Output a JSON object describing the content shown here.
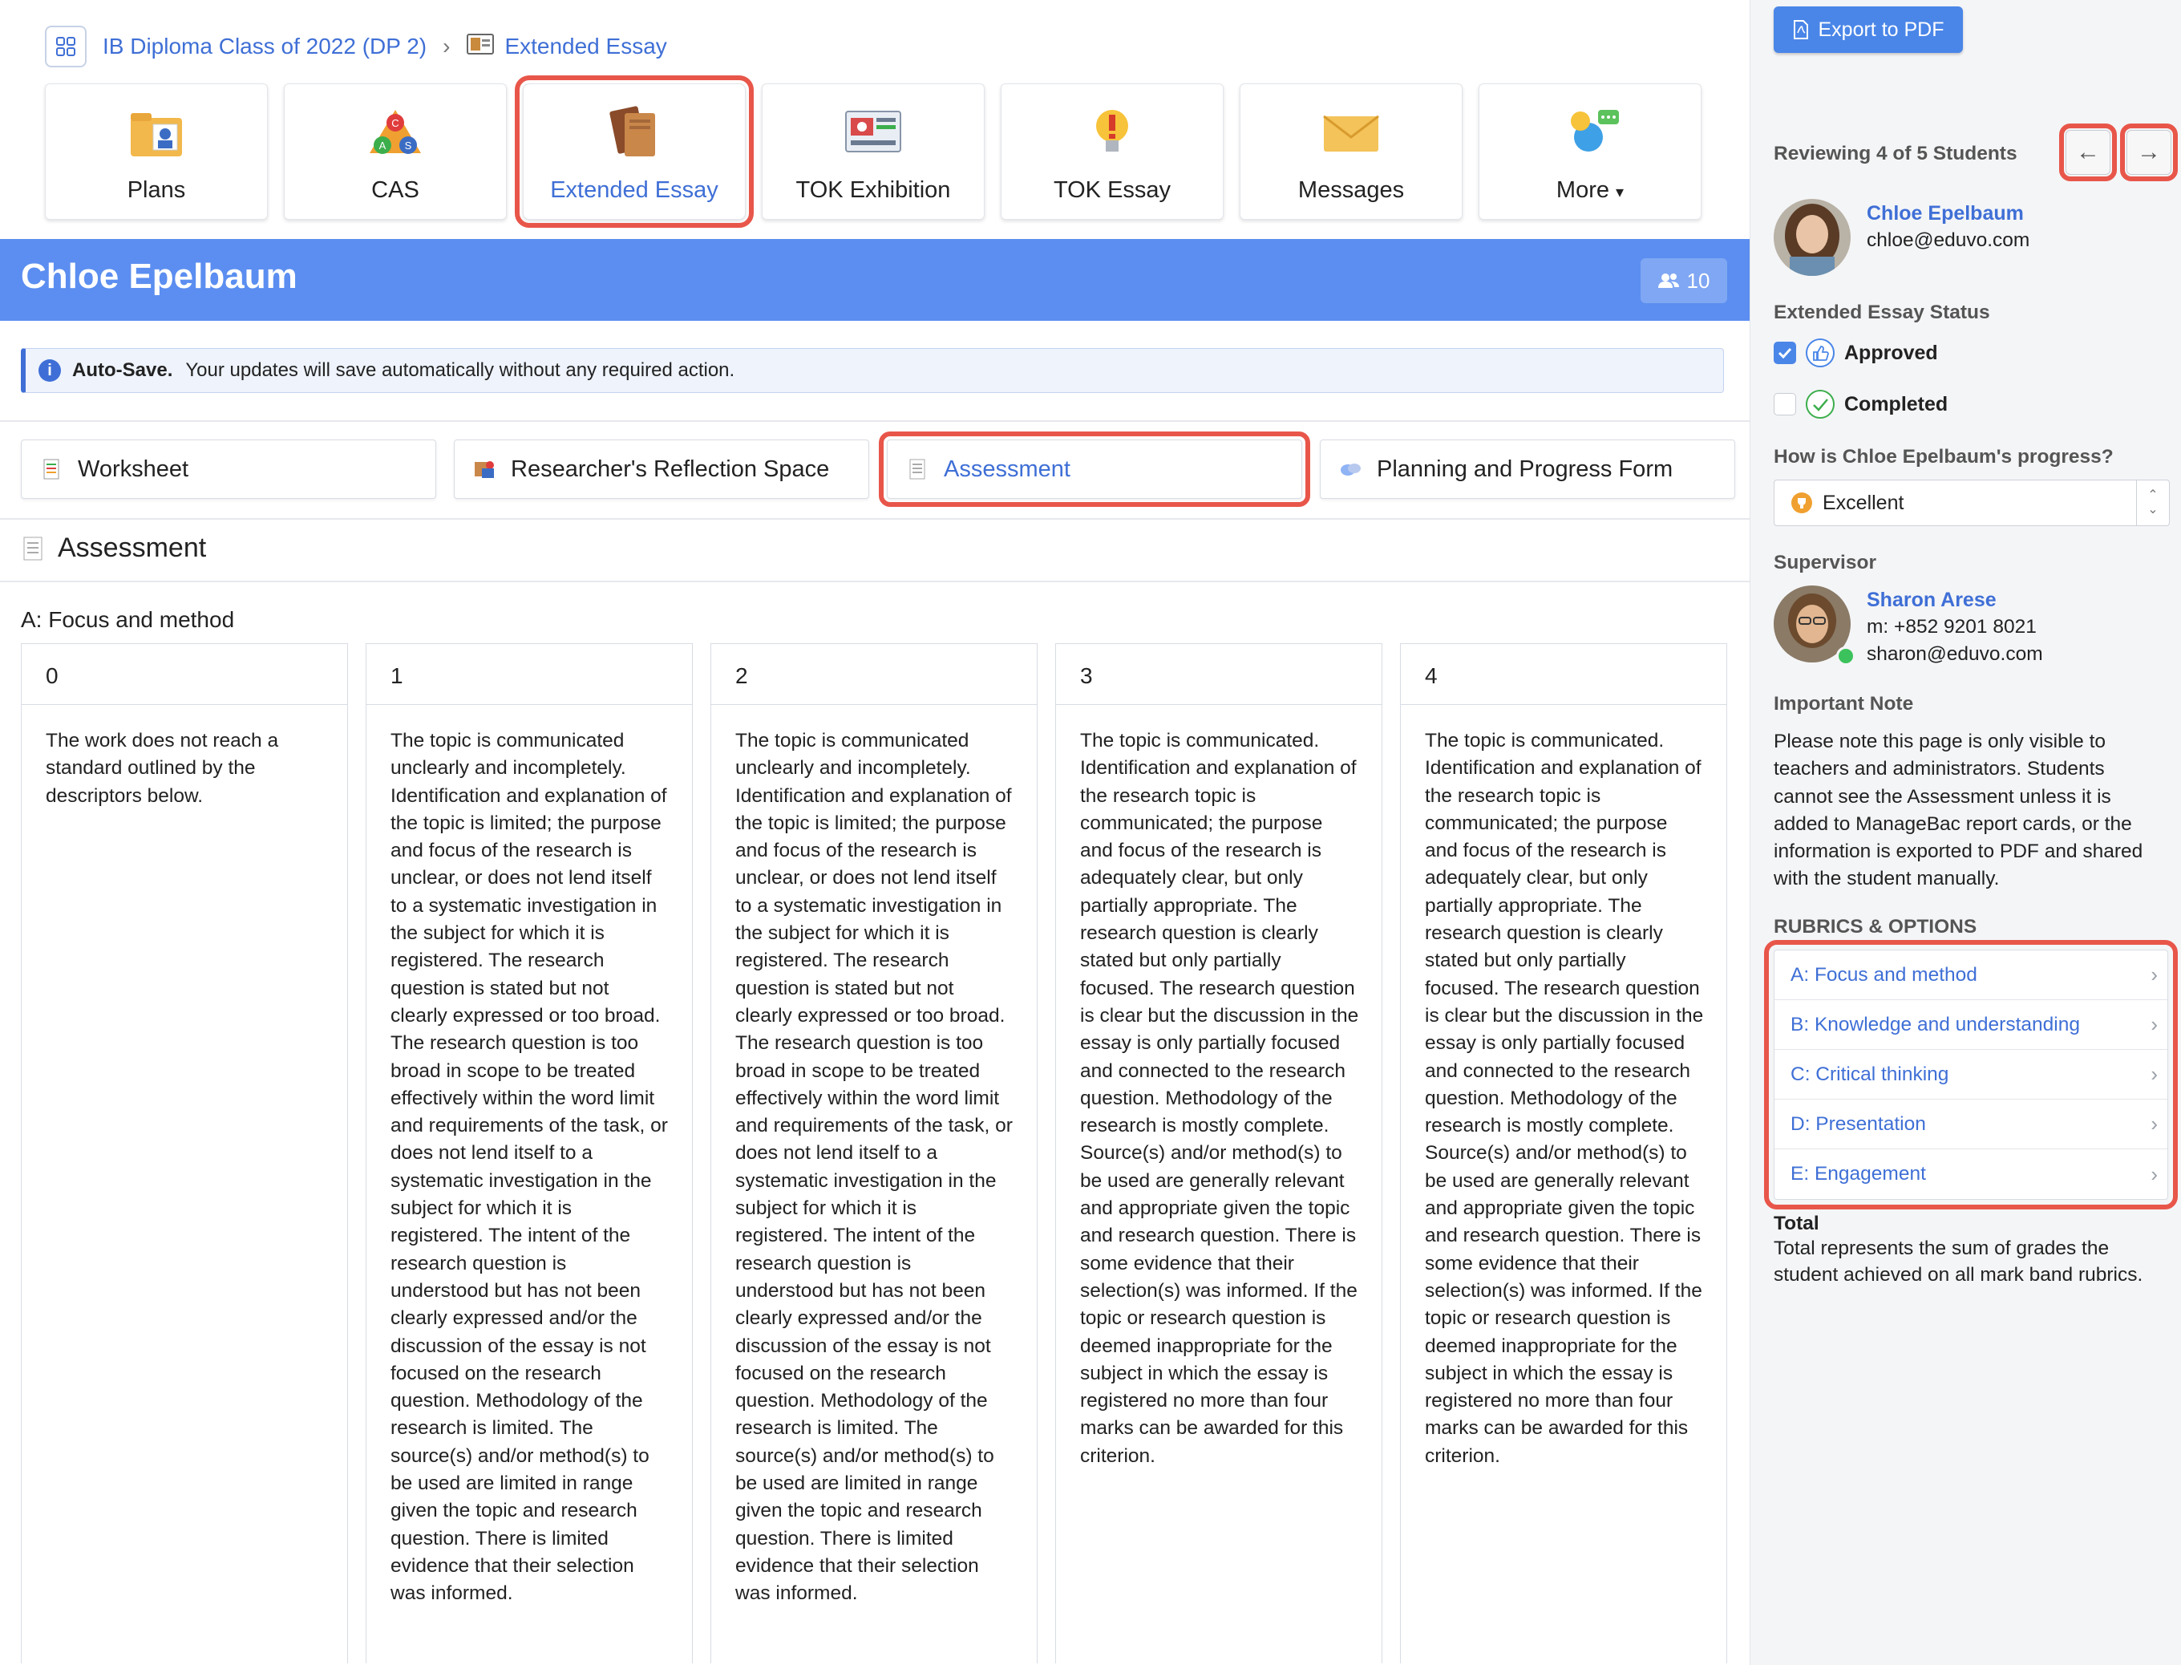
{
  "breadcrumb": {
    "class_name": "IB Diploma Class of 2022 (DP 2)",
    "current": "Extended Essay"
  },
  "tiles": [
    {
      "label": "Plans",
      "icon": "plans-icon"
    },
    {
      "label": "CAS",
      "icon": "cas-icon"
    },
    {
      "label": "Extended Essay",
      "icon": "extended-essay-icon",
      "active": true
    },
    {
      "label": "TOK Exhibition",
      "icon": "tok-exhibition-icon"
    },
    {
      "label": "TOK Essay",
      "icon": "tok-essay-icon"
    },
    {
      "label": "Messages",
      "icon": "messages-icon"
    },
    {
      "label": "More",
      "icon": "more-icon"
    }
  ],
  "header": {
    "student_name": "Chloe Epelbaum",
    "member_count": "10"
  },
  "autosave": {
    "label": "Auto-Save.",
    "message": "Your updates will save automatically without any required action."
  },
  "subtabs": [
    {
      "label": "Worksheet",
      "icon": "worksheet-icon"
    },
    {
      "label": "Researcher's Reflection Space",
      "icon": "reflection-icon"
    },
    {
      "label": "Assessment",
      "icon": "assessment-icon",
      "active": true
    },
    {
      "label": "Planning and Progress Form",
      "icon": "planning-icon"
    }
  ],
  "section_title": "Assessment",
  "criterion": {
    "title": "A: Focus and method",
    "columns": [
      {
        "score": "0",
        "text": "The work does not reach a standard outlined by the descriptors below."
      },
      {
        "score": "1",
        "text": "The topic is communicated unclearly and incompletely. Identification and explanation of the topic is limited; the purpose and focus of the research is unclear, or does not lend itself to a systematic investigation in the subject for which it is registered. The research question is stated but not clearly expressed or too broad. The research question is too broad in scope to be treated effectively within the word limit and requirements of the task, or does not lend itself to a systematic investigation in the subject for which it is registered. The intent of the research question is understood but has not been clearly expressed and/or the discussion of the essay is not focused on the research question. Methodology of the research is limited. The source(s) and/or method(s) to be used are limited in range given the topic and research question. There is limited evidence that their selection was informed."
      },
      {
        "score": "2",
        "text": "The topic is communicated unclearly and incompletely. Identification and explanation of the topic is limited; the purpose and focus of the research is unclear, or does not lend itself to a systematic investigation in the subject for which it is registered. The research question is stated but not clearly expressed or too broad. The research question is too broad in scope to be treated effectively within the word limit and requirements of the task, or does not lend itself to a systematic investigation in the subject for which it is registered. The intent of the research question is understood but has not been clearly expressed and/or the discussion of the essay is not focused on the research question. Methodology of the research is limited. The source(s) and/or method(s) to be used are limited in range given the topic and research question. There is limited evidence that their selection was informed."
      },
      {
        "score": "3",
        "text": "The topic is communicated. Identification and explanation of the research topic is communicated; the purpose and focus of the research is adequately clear, but only partially appropriate. The research question is clearly stated but only partially focused. The research question is clear but the discussion in the essay is only partially focused and connected to the research question. Methodology of the research is mostly complete. Source(s) and/or method(s) to be used are generally relevant and appropriate given the topic and research question. There is some evidence that their selection(s) was informed. If the topic or research question is deemed inappropriate for the subject in which the essay is registered no more than four marks can be awarded for this criterion."
      },
      {
        "score": "4",
        "text": "The topic is communicated. Identification and explanation of the research topic is communicated; the purpose and focus of the research is adequately clear, but only partially appropriate. The research question is clearly stated but only partially focused. The research question is clear but the discussion in the essay is only partially focused and connected to the research question. Methodology of the research is mostly complete. Source(s) and/or method(s) to be used are generally relevant and appropriate given the topic and research question. There is some evidence that their selection(s) was informed. If the topic or research question is deemed inappropriate for the subject in which the essay is registered no more than four marks can be awarded for this criterion."
      }
    ]
  },
  "panel": {
    "export_label": "Export to PDF",
    "reviewing": "Reviewing 4 of 5 Students",
    "student": {
      "name": "Chloe Epelbaum",
      "email": "chloe@eduvo.com"
    },
    "status_title": "Extended Essay Status",
    "status": [
      {
        "label": "Approved",
        "checked": true
      },
      {
        "label": "Completed",
        "checked": false
      }
    ],
    "progress_question": "How is Chloe Epelbaum's progress?",
    "progress_value": "Excellent",
    "supervisor_title": "Supervisor",
    "supervisor": {
      "name": "Sharon Arese",
      "phone": "m: +852 9201 8021",
      "email": "sharon@eduvo.com"
    },
    "important_title": "Important Note",
    "important_text": "Please note this page is only visible to teachers and administrators. Students cannot see the Assessment unless it is added to ManageBac report cards, or the information is exported to PDF and shared with the student manually.",
    "rubrics_title": "RUBRICS & OPTIONS",
    "rubrics": [
      "A: Focus and method",
      "B: Knowledge and understanding",
      "C: Critical thinking",
      "D: Presentation",
      "E: Engagement"
    ],
    "total_title": "Total",
    "total_text": "Total represents the sum of grades the student achieved on all mark band rubrics."
  },
  "colors": {
    "accent": "#3f6fd6",
    "header_band": "#5b8ef0",
    "highlight": "#e8564a"
  }
}
